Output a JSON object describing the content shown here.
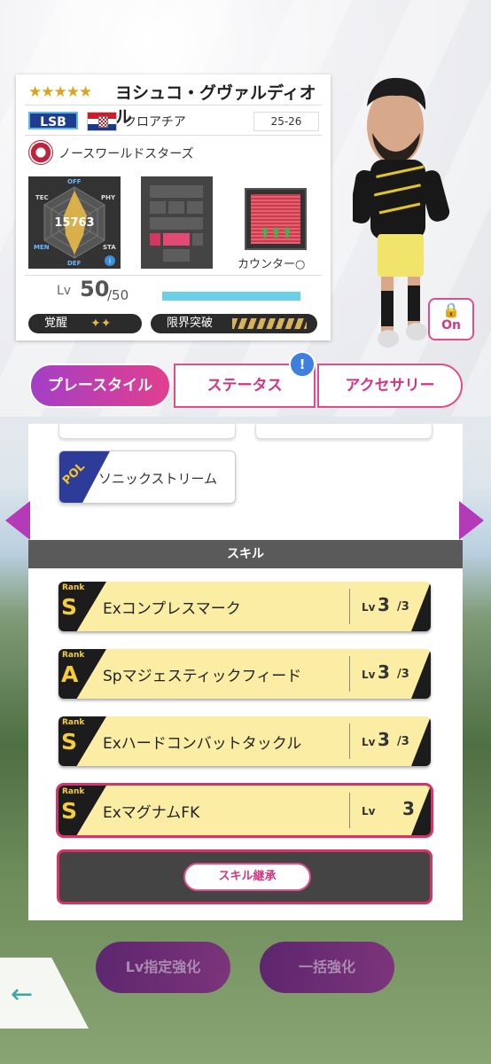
{
  "player": {
    "stars": "★★★★★",
    "name": "ヨシュコ・グヴァルディオル",
    "position": "LSB",
    "country": "クロアチア",
    "season": "25-26",
    "club": "ノースワールドスターズ",
    "stat_total": "15763",
    "radar_labels": {
      "off": "OFF",
      "tec": "TEC",
      "phy": "PHY",
      "men": "MEN",
      "sta": "STA",
      "def": "DEF"
    },
    "counter_label": "カウンター○",
    "lv_label": "Lv",
    "level": "50",
    "level_max": "/50",
    "awaken_label": "覚醒",
    "limit_label": "限界突破",
    "lock_label": "On"
  },
  "tabs": [
    {
      "label": "プレースタイル"
    },
    {
      "label": "ステータス"
    },
    {
      "label": "アクセサリー"
    }
  ],
  "tab_badge": "!",
  "playstyle": {
    "tag": "POL",
    "name": "ソニックストリーム"
  },
  "skills_header": "スキル",
  "skills": [
    {
      "rank_label": "Rank",
      "rank": "S",
      "name": "Exコンプレスマーク",
      "lv_label": "Lv",
      "lv": "3",
      "lv_max": "/3"
    },
    {
      "rank_label": "Rank",
      "rank": "A",
      "name": "Spマジェスティックフィード",
      "lv_label": "Lv",
      "lv": "3",
      "lv_max": "/3"
    },
    {
      "rank_label": "Rank",
      "rank": "S",
      "name": "Exハードコンバットタックル",
      "lv_label": "Lv",
      "lv": "3",
      "lv_max": "/3"
    },
    {
      "rank_label": "Rank",
      "rank": "S",
      "name": "ExマグナムFK",
      "lv_label": "Lv",
      "lv": "3",
      "lv_max": ""
    }
  ],
  "inherit_button": "スキル継承",
  "bottom": {
    "lv_enhance": "Lv指定強化",
    "bulk_enhance": "一括強化",
    "back": "←"
  }
}
